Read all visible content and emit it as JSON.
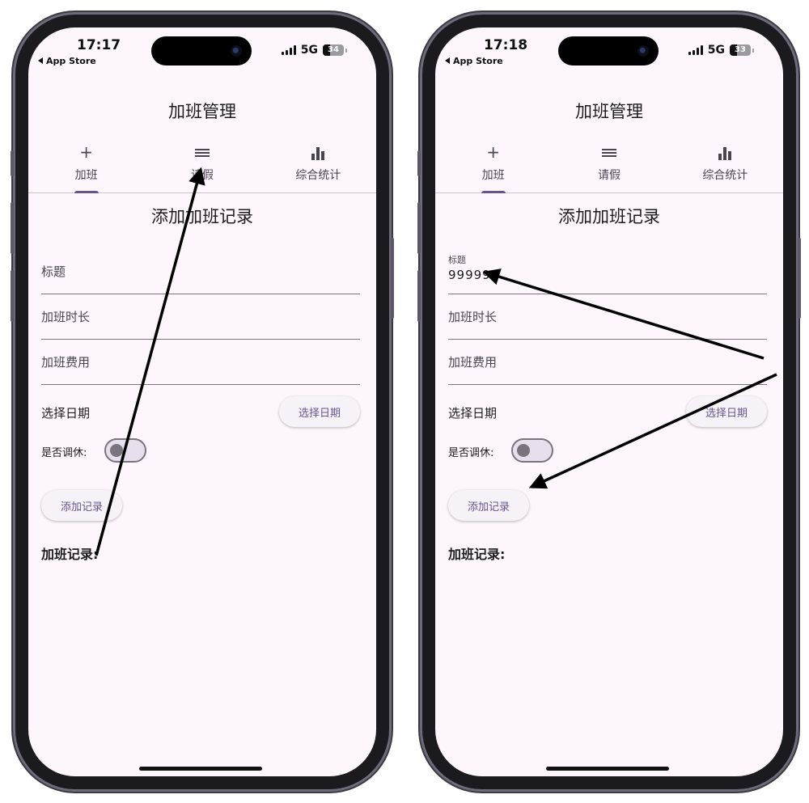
{
  "screens": [
    {
      "status": {
        "time": "17:17",
        "back_label": "App Store",
        "network": "5G",
        "battery": "34",
        "battery_fraction": 0.34
      },
      "app_title": "加班管理",
      "tabs": [
        {
          "icon": "plus-icon",
          "label": "加班",
          "selected": true
        },
        {
          "icon": "list-icon",
          "label": "请假",
          "selected": false
        },
        {
          "icon": "bar-chart-icon",
          "label": "综合统计",
          "selected": false
        }
      ],
      "form_title": "添加加班记录",
      "fields": [
        {
          "label": "标题",
          "value": ""
        },
        {
          "label": "加班时长",
          "value": ""
        },
        {
          "label": "加班费用",
          "value": ""
        }
      ],
      "date_label": "选择日期",
      "date_button": "选择日期",
      "switch_label": "是否调休:",
      "switch_on": false,
      "add_button": "添加记录",
      "records_title": "加班记录:"
    },
    {
      "status": {
        "time": "17:18",
        "back_label": "App Store",
        "network": "5G",
        "battery": "33",
        "battery_fraction": 0.33
      },
      "app_title": "加班管理",
      "tabs": [
        {
          "icon": "plus-icon",
          "label": "加班",
          "selected": true
        },
        {
          "icon": "list-icon",
          "label": "请假",
          "selected": false
        },
        {
          "icon": "bar-chart-icon",
          "label": "综合统计",
          "selected": false
        }
      ],
      "form_title": "添加加班记录",
      "fields": [
        {
          "label": "标题",
          "value": "999999"
        },
        {
          "label": "加班时长",
          "value": ""
        },
        {
          "label": "加班费用",
          "value": ""
        }
      ],
      "date_label": "选择日期",
      "date_button": "选择日期",
      "switch_label": "是否调休:",
      "switch_on": false,
      "add_button": "添加记录",
      "records_title": "加班记录:"
    }
  ],
  "colors": {
    "screen_bg": "#fdf7fd",
    "accent": "#65558f",
    "outline": "#79747e",
    "frame": "#1b1a1e",
    "annotation_arrow": "#000000"
  }
}
